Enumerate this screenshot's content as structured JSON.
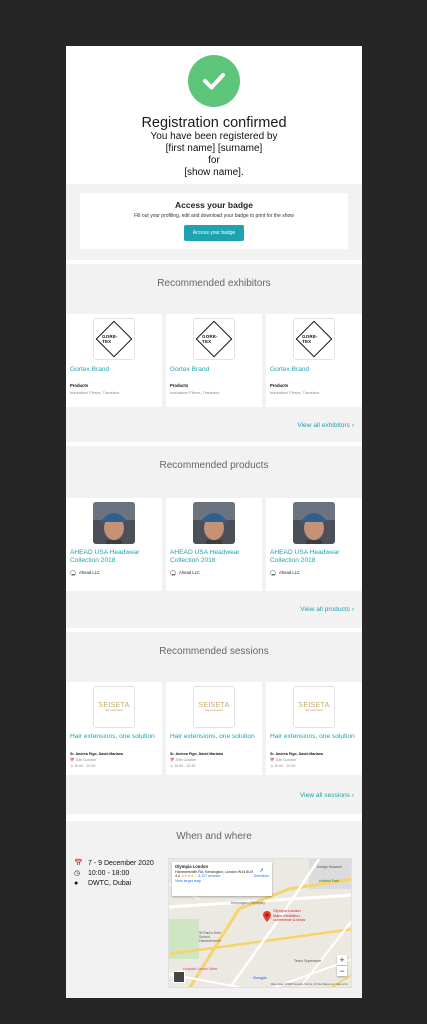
{
  "hero": {
    "title": "Registration confirmed",
    "line1": "You have been registered by",
    "line2": "[first name] [surname]",
    "line3": "for",
    "line4": "[show name]."
  },
  "badge": {
    "title": "Access your badge",
    "subtitle": "Fill out your profiling, edit and download your badge to print for the show",
    "button": "Access your badge"
  },
  "exhibitors": {
    "heading": "Recommended exhibitors",
    "logo_text": "GORE-TEX",
    "items": [
      {
        "name": "Gortex Brand",
        "label": "Products",
        "detail": "Insulation/ Fibres, Transfers"
      },
      {
        "name": "Gortex Brand",
        "label": "Products",
        "detail": "Insulation/ Fibres, Transfers"
      },
      {
        "name": "Gortex Brand",
        "label": "Products",
        "detail": "Insulation/ Fibres, Transfers"
      }
    ],
    "view_all": "View all exhibitors ›"
  },
  "products": {
    "heading": "Recommended products",
    "items": [
      {
        "name": "AHEAD USA Headwear Collection 2018",
        "company": "Ahead LLC"
      },
      {
        "name": "AHEAD USA Headwear Collection 2018",
        "company": "Ahead LLC"
      },
      {
        "name": "AHEAD USA Headwear Collection 2018",
        "company": "Ahead LLC"
      }
    ],
    "view_all": "View all products ›"
  },
  "sessions": {
    "heading": "Recommended sessions",
    "logo_word": "SEISETA",
    "logo_sub": "hair extensions",
    "items": [
      {
        "name": "Hair extensions, one solution",
        "speakers": "Sr. Andrea Pigo, David Mariano",
        "date": "30th October",
        "time": "10:00 - 10:30"
      },
      {
        "name": "Hair extensions, one solution",
        "speakers": "Sr. Andrea Pigo, David Mariano",
        "date": "30th October",
        "time": "10:00 - 10:30"
      },
      {
        "name": "Hair extensions, one solution",
        "speakers": "Sr. Andrea Pigo, David Mariano",
        "date": "30th October",
        "time": "10:00 - 10:30"
      }
    ],
    "view_all": "View all sessions ›"
  },
  "when_where": {
    "heading": "When and where",
    "dates": "7 - 9 December 2020",
    "time": "10:00 - 18:00",
    "location": "DWTC, Dubai"
  },
  "map": {
    "place": "Olympia London",
    "address": "Hammersmith Rd, Kensington, London W14 8UX",
    "rating": "4.4",
    "stars": "★★★★☆",
    "reviews": "3,127 reviews",
    "larger_map": "View larger map",
    "directions": "Directions",
    "pin_label": "Olympia London",
    "pin_sub": "Major exhibition, conference & show",
    "labels": {
      "kensington": "Kensington (Olympia)",
      "pauls": "St Paul's Girls' School, Hammersmith",
      "hospital": "Hospital London West",
      "tesco": "Tesco Superstore",
      "design": "Design Museum",
      "holland": "Holland Park"
    },
    "google": "Google",
    "footer": "Map data ©2020 Google   Terms of Use   Report a map error"
  },
  "colors": {
    "accent": "#1fa3b1",
    "success": "#5cc57a"
  }
}
